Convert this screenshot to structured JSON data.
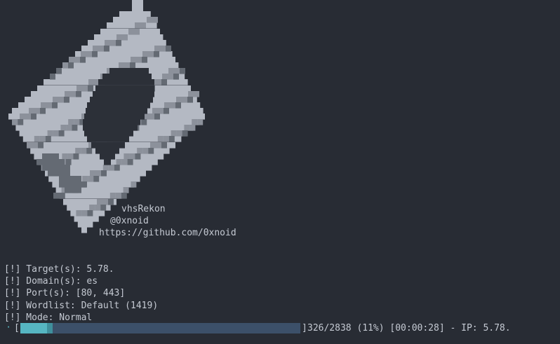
{
  "banner": {
    "tool_name": "vhsRekon",
    "author": "@0xnoid",
    "url": "https://github.com/0xnoid"
  },
  "info": {
    "target": "[!] Target(s): 5.78.",
    "domain": "[!] Domain(s): es",
    "ports": "[!] Port(s): [80, 443]",
    "wordlist": "[!] Wordlist: Default (1419)",
    "mode": "[!] Mode: Normal"
  },
  "progress": {
    "spinner": "⠐",
    "open_bracket": "[",
    "close_bracket": "]",
    "fraction": 0.115,
    "status": "326/2838 (11%) [00:00:28] - IP: 5.78."
  },
  "colors": {
    "background": "#282c34",
    "text": "#c5cad3",
    "bar_fill": "#56b6c2",
    "bar_track": "#3c5069",
    "art_light": "#b4b9c3",
    "art_mid": "#8c919b",
    "art_dark": "#646a73",
    "art_shadow": "#4a5059"
  }
}
